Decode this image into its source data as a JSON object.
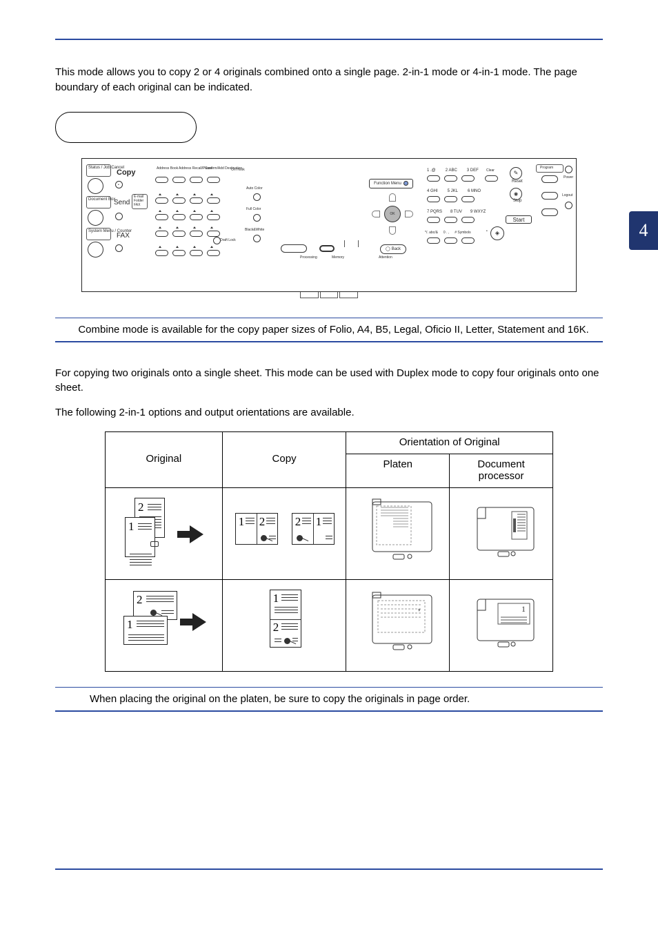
{
  "intro": "This mode allows you to copy 2 or 4 originals combined onto a single page. 2-in-1 mode or 4-in-1 mode. The page boundary of each original can be indicated.",
  "right_tab": "4",
  "note1": "Combine mode is available for the copy paper sizes of Folio, A4, B5, Legal, Oficio II, Letter, Statement and 16K.",
  "sec2_p1": "For copying two originals onto a single sheet. This mode can be used with Duplex mode to copy four originals onto one sheet.",
  "sec2_p2": "The following 2-in-1 options and output orientations are available.",
  "table": {
    "h1": "Original",
    "h2": "Copy",
    "h3": "Orientation of Original",
    "h3a": "Platen",
    "h3b": "Document processor"
  },
  "note2": "When placing the original on the platen, be sure to copy the originals in page order.",
  "panel": {
    "copy": "Copy",
    "send": "Send",
    "fax": "FAX",
    "status": "Status /\nJob Cancel",
    "docbox": "Document\nBox",
    "sysmenu": "System Menu /\nCounter",
    "addrbook": "Address\nBook",
    "addrrecall": "Address\nRecall/Pause",
    "confirm": "Confirm/Add\nDestination",
    "onhook": "On Hook",
    "autocolor": "Auto Color",
    "fullcolor": "Full Color",
    "bw": "Black&White",
    "funcmenu": "Function Menu",
    "back": "Back",
    "processing": "Processing",
    "memory": "Memory",
    "attention": "Attention",
    "ok": "OK",
    "clear": "Clear",
    "reset": "Reset",
    "stop": "Stop",
    "start": "Start",
    "program": "Program",
    "power": "Power",
    "logout": "Logout",
    "k1": "1 .@",
    "k2": "2 ABC",
    "k3": "3 DEF",
    "k4": "4 GHI",
    "k5": "5 JKL",
    "k6": "6 MNO",
    "k7": "7 PQRS",
    "k8": "8 TUV",
    "k9": "9 WXYZ",
    "kstar": "*/. abc/&",
    "k0": "0 . ,",
    "khash": "# Symbols",
    "email": "E-mail",
    "folder": "Folder",
    "faxsmall": "FAX",
    "draft": "Draft Lock"
  }
}
